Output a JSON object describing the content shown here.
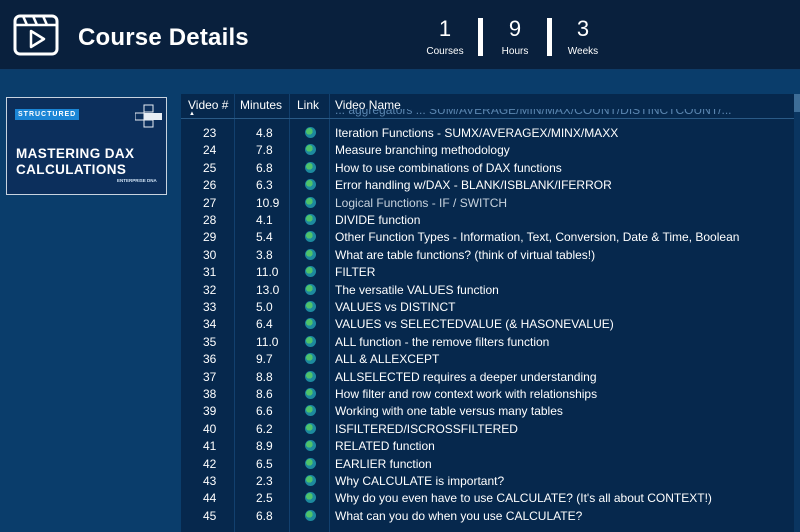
{
  "header": {
    "title": "Course Details",
    "logo_icon": "video-play-icon",
    "stats": [
      {
        "value": "1",
        "label": "Courses"
      },
      {
        "value": "9",
        "label": "Hours"
      },
      {
        "value": "3",
        "label": "Weeks"
      }
    ]
  },
  "thumbnail": {
    "badge": "STRUCTURED",
    "course_line1": "MASTERING DAX",
    "course_line2": "CALCULATIONS",
    "brand": "ENTERPRISE DNA",
    "icon": "cube-icon"
  },
  "table": {
    "columns": [
      "Video #",
      "Minutes",
      "Link",
      "Video Name"
    ],
    "sort_indicator": "▲",
    "link_icon": "globe-icon",
    "partial_row_text": "... aggregators ... SUM/AVERAGE/MIN/MAX/COUNT/DISTINCTCOUNT/...",
    "rows": [
      {
        "id": "23",
        "minutes": "4.8",
        "name": "Iteration Functions - SUMX/AVERAGEX/MINX/MAXX"
      },
      {
        "id": "24",
        "minutes": "7.8",
        "name": "Measure branching methodology"
      },
      {
        "id": "25",
        "minutes": "6.8",
        "name": "How to use combinations of DAX functions"
      },
      {
        "id": "26",
        "minutes": "6.3",
        "name": "Error handling w/DAX - BLANK/ISBLANK/IFERROR"
      },
      {
        "id": "27",
        "minutes": "10.9",
        "name": "Logical Functions - IF / SWITCH"
      },
      {
        "id": "28",
        "minutes": "4.1",
        "name": "DIVIDE function"
      },
      {
        "id": "29",
        "minutes": "5.4",
        "name": "Other Function Types - Information, Text, Conversion, Date & Time, Boolean"
      },
      {
        "id": "30",
        "minutes": "3.8",
        "name": "What are table functions? (think of virtual tables!)"
      },
      {
        "id": "31",
        "minutes": "11.0",
        "name": "FILTER"
      },
      {
        "id": "32",
        "minutes": "13.0",
        "name": "The versatile VALUES function"
      },
      {
        "id": "33",
        "minutes": "5.0",
        "name": "VALUES vs DISTINCT"
      },
      {
        "id": "34",
        "minutes": "6.4",
        "name": "VALUES vs SELECTEDVALUE (& HASONEVALUE)"
      },
      {
        "id": "35",
        "minutes": "11.0",
        "name": "ALL function - the remove filters function"
      },
      {
        "id": "36",
        "minutes": "9.7",
        "name": "ALL & ALLEXCEPT"
      },
      {
        "id": "37",
        "minutes": "8.8",
        "name": "ALLSELECTED requires a deeper understanding"
      },
      {
        "id": "38",
        "minutes": "8.6",
        "name": "How filter and row context work with relationships"
      },
      {
        "id": "39",
        "minutes": "6.6",
        "name": "Working with one table versus many tables"
      },
      {
        "id": "40",
        "minutes": "6.2",
        "name": "ISFILTERED/ISCROSSFILTERED"
      },
      {
        "id": "41",
        "minutes": "8.9",
        "name": "RELATED function"
      },
      {
        "id": "42",
        "minutes": "6.5",
        "name": "EARLIER function"
      },
      {
        "id": "43",
        "minutes": "2.3",
        "name": "Why CALCULATE is important?"
      },
      {
        "id": "44",
        "minutes": "2.5",
        "name": "Why do you even have to use CALCULATE? (It's all about CONTEXT!)"
      },
      {
        "id": "45",
        "minutes": "6.8",
        "name": "What can you do when you use CALCULATE?"
      }
    ],
    "highlighted_row": "27"
  }
}
